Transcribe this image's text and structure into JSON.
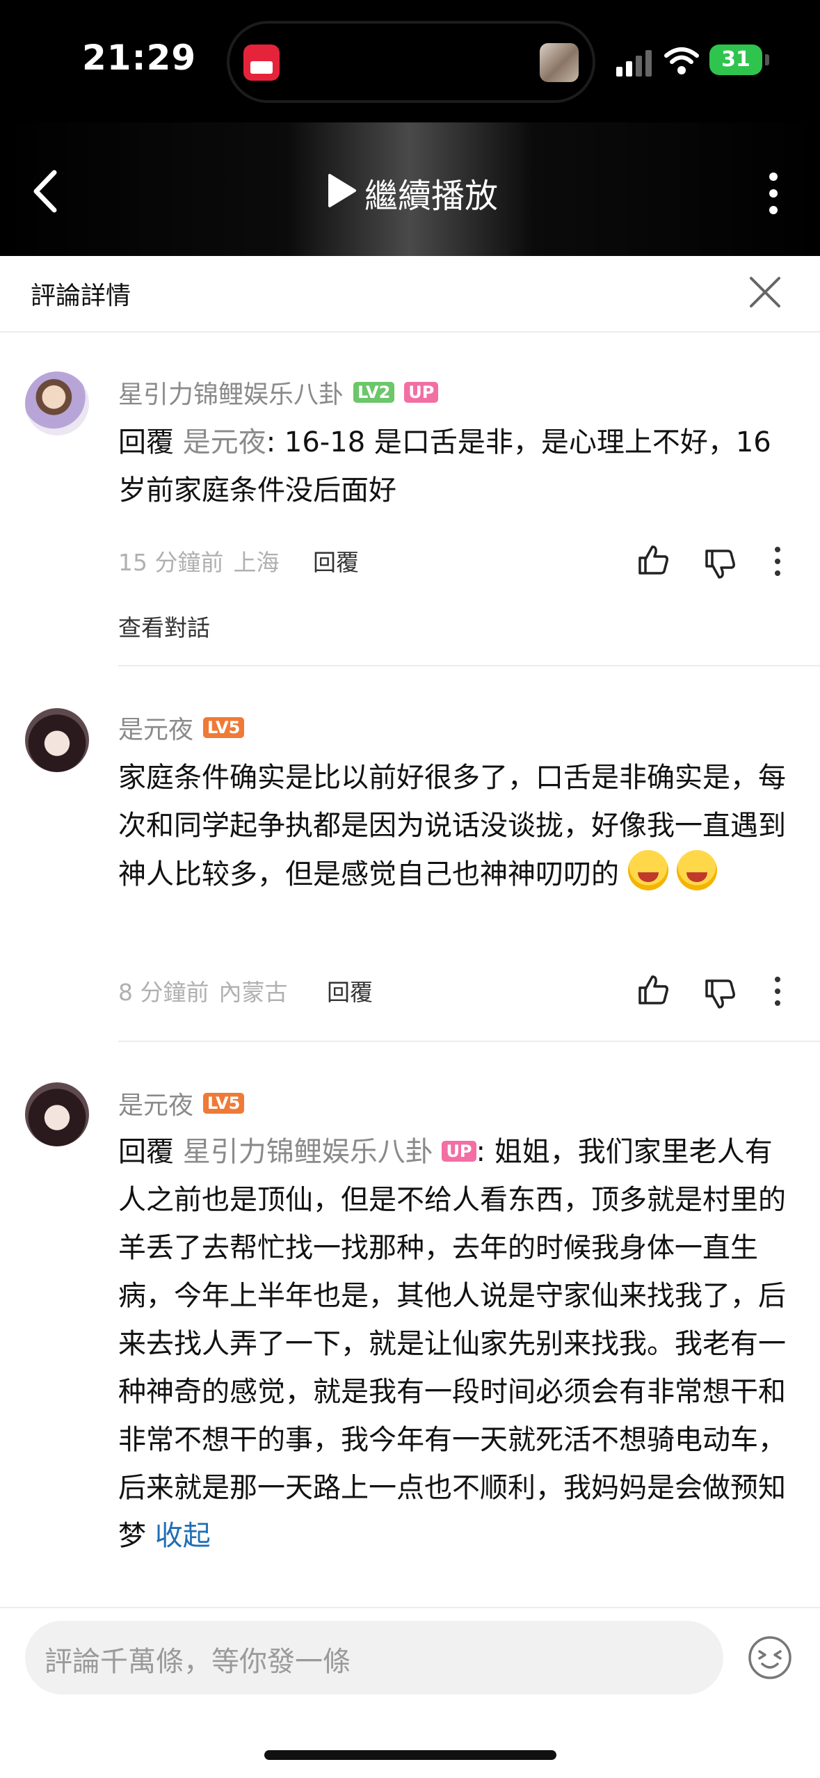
{
  "status_bar": {
    "time": "21:29",
    "battery": "31"
  },
  "video_header": {
    "continue_label": "繼續播放"
  },
  "comment_panel": {
    "title": "評論詳情"
  },
  "comments": [
    {
      "username": "星引力锦鲤娱乐八卦",
      "level": "LV2",
      "up_badge": "UP",
      "reply_prefix": "回覆",
      "reply_to": "是元夜",
      "text": ": 16-18 是口舌是非，是心理上不好，16 岁前家庭条件没后面好",
      "time": "15 分鐘前",
      "location": "上海",
      "reply_label": "回覆",
      "view_conversation": "查看對話"
    },
    {
      "username": "是元夜",
      "level": "LV5",
      "text": "家庭条件确实是比以前好很多了，口舌是非确实是，每次和同学起争执都是因为说话没谈拢，好像我一直遇到神人比较多，但是感觉自己也神神叨叨的",
      "time": "8 分鐘前",
      "location": "內蒙古",
      "reply_label": "回覆"
    },
    {
      "username": "是元夜",
      "level": "LV5",
      "reply_prefix": "回覆",
      "reply_to": "星引力锦鲤娱乐八卦",
      "reply_to_badge": "UP",
      "text": ": 姐姐，我们家里老人有人之前也是顶仙，但是不给人看东西，顶多就是村里的羊丢了去帮忙找一找那种，去年的时候我身体一直生病，今年上半年也是，其他人说是守家仙来找我了，后来去找人弄了一下，就是让仙家先别来找我。我老有一种神奇的感觉，就是我有一段时间必须会有非常想干和非常不想干的事，我今年有一天就死活不想骑电动车，后来就是那一天路上一点也不顺利，我妈妈是会做预知梦",
      "collapse_label": "收起"
    }
  ],
  "composer": {
    "placeholder": "評論千萬條，等你發一條"
  },
  "colors": {
    "accent_link": "#1f6fb5",
    "lv2": "#6cc66a",
    "lv5": "#ef7a37",
    "up": "#f26fa4"
  }
}
